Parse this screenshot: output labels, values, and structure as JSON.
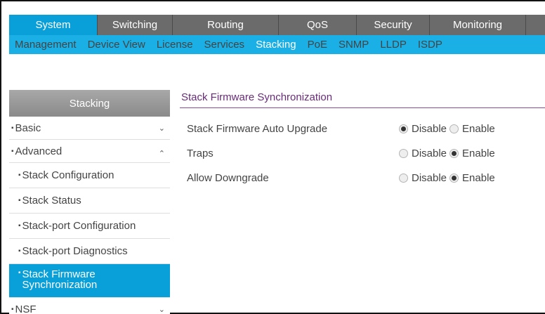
{
  "topnav": [
    "System",
    "Switching",
    "Routing",
    "QoS",
    "Security",
    "Monitoring"
  ],
  "subnav": [
    "Management",
    "Device View",
    "License",
    "Services",
    "Stacking",
    "PoE",
    "SNMP",
    "LLDP",
    "ISDP"
  ],
  "sidebar": {
    "header": "Stacking",
    "basic": "Basic",
    "advanced": "Advanced",
    "items": [
      "Stack Configuration",
      "Stack Status",
      "Stack-port Configuration",
      "Stack-port Diagnostics",
      "Stack Firmware Synchronization"
    ],
    "nsf": "NSF",
    "active_item": "Stack Firmware Synchronization"
  },
  "content": {
    "title": "Stack Firmware Synchronization",
    "rows": [
      {
        "label": "Stack Firmware Auto Upgrade",
        "selected": "Disable"
      },
      {
        "label": "Traps",
        "selected": "Enable"
      },
      {
        "label": "Allow Downgrade",
        "selected": "Enable"
      }
    ],
    "option_disable": "Disable",
    "option_enable": "Enable"
  },
  "colors": {
    "accent_blue": "#09a0da",
    "subnav_blue": "#1ab0e6",
    "title_purple": "#6a2a7a"
  }
}
